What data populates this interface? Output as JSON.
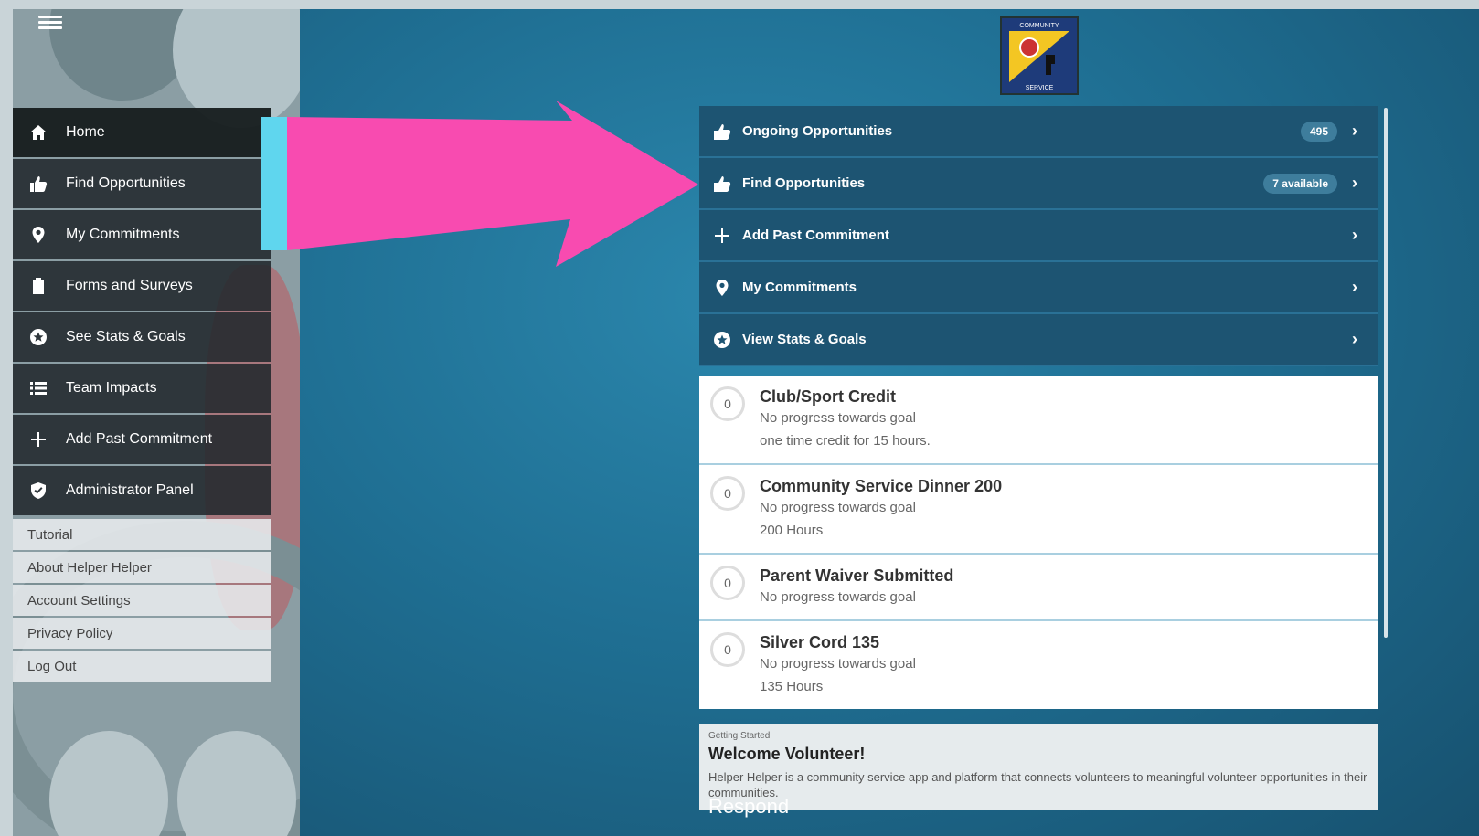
{
  "sidebar": {
    "nav": [
      {
        "label": "Home",
        "icon": "home-icon"
      },
      {
        "label": "Find Opportunities",
        "icon": "thumbs-up-icon"
      },
      {
        "label": "My Commitments",
        "icon": "map-pin-icon"
      },
      {
        "label": "Forms and Surveys",
        "icon": "clipboard-icon"
      },
      {
        "label": "See Stats & Goals",
        "icon": "star-circle-icon"
      },
      {
        "label": "Team Impacts",
        "icon": "list-icon"
      },
      {
        "label": "Add Past Commitment",
        "icon": "plus-icon"
      },
      {
        "label": "Administrator Panel",
        "icon": "shield-check-icon"
      }
    ],
    "links": [
      "Tutorial",
      "About Helper Helper",
      "Account Settings",
      "Privacy Policy",
      "Log Out"
    ]
  },
  "menu": [
    {
      "label": "Ongoing Opportunities",
      "badge": "495",
      "icon": "thumbs-up-icon"
    },
    {
      "label": "Find Opportunities",
      "badge": "7 available",
      "icon": "thumbs-up-icon"
    },
    {
      "label": "Add Past Commitment",
      "badge": "",
      "icon": "plus-icon"
    },
    {
      "label": "My Commitments",
      "badge": "",
      "icon": "map-pin-icon"
    },
    {
      "label": "View Stats & Goals",
      "badge": "",
      "icon": "star-circle-icon"
    }
  ],
  "goals": [
    {
      "progress": "0",
      "title": "Club/Sport Credit",
      "status": "No progress towards goal",
      "detail": "one time credit for 15 hours."
    },
    {
      "progress": "0",
      "title": "Community Service Dinner 200",
      "status": "No progress towards goal",
      "detail": "200 Hours"
    },
    {
      "progress": "0",
      "title": "Parent Waiver Submitted",
      "status": "No progress towards goal",
      "detail": ""
    },
    {
      "progress": "0",
      "title": "Silver Cord 135",
      "status": "No progress towards goal",
      "detail": "135 Hours"
    }
  ],
  "welcome": {
    "kicker": "Getting Started",
    "title": "Welcome Volunteer!",
    "body": "Helper Helper is a community service app and platform that connects volunteers to meaningful volunteer opportunities in their communities."
  },
  "respond": "Respond",
  "logo": {
    "top_text": "COMMUNITY",
    "bottom_text": "SERVICE"
  },
  "colors": {
    "arrow": "#f84bb0",
    "arrow_tail": "#5fd6ee",
    "menu_bg": "#1d5472"
  }
}
